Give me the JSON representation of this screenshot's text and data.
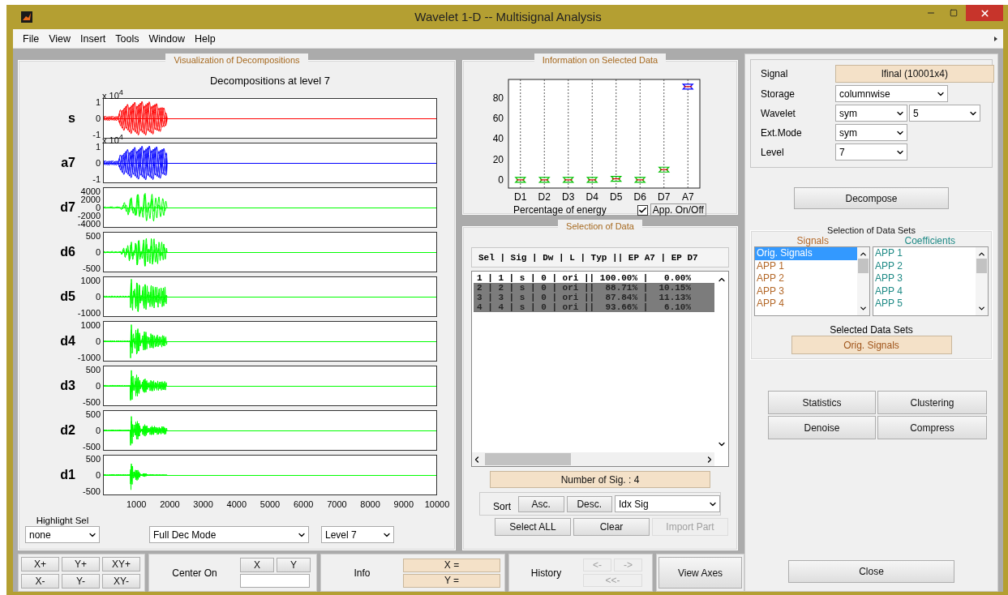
{
  "window": {
    "title": "Wavelet 1-D -- Multisignal Analysis"
  },
  "menu": [
    "File",
    "View",
    "Insert",
    "Tools",
    "Window",
    "Help"
  ],
  "decompositions": {
    "panel_title": "Visualization of Decompositions",
    "title": "Decompositions at level 7",
    "plots": [
      {
        "label": "s",
        "exponent": "x 10$^{4}$",
        "yticks": [
          "1",
          "0",
          "-1"
        ],
        "color": "#ff0000"
      },
      {
        "label": "a7",
        "exponent": "x 10$^{4}$",
        "yticks": [
          "1",
          "0",
          "-1"
        ],
        "color": "#0000ff"
      },
      {
        "label": "d7",
        "yticks": [
          "4000",
          "2000",
          "0",
          "-2000",
          "-4000"
        ],
        "color": "#00ff00"
      },
      {
        "label": "d6",
        "yticks": [
          "500",
          "0",
          "-500"
        ],
        "color": "#00ff00"
      },
      {
        "label": "d5",
        "yticks": [
          "1000",
          "0",
          "-1000"
        ],
        "color": "#00ff00"
      },
      {
        "label": "d4",
        "yticks": [
          "1000",
          "0",
          "-1000"
        ],
        "color": "#00ff00"
      },
      {
        "label": "d3",
        "yticks": [
          "500",
          "0",
          "-500"
        ],
        "color": "#00ff00"
      },
      {
        "label": "d2",
        "yticks": [
          "500",
          "0",
          "-500"
        ],
        "color": "#00ff00"
      },
      {
        "label": "d1",
        "yticks": [
          "500",
          "0",
          "-500"
        ],
        "color": "#00ff00"
      }
    ],
    "xticks": [
      "1000",
      "2000",
      "3000",
      "4000",
      "5000",
      "6000",
      "7000",
      "8000",
      "9000",
      "10000"
    ],
    "highlight": {
      "label": "Highlight Sel",
      "value": "none"
    },
    "mode": {
      "value": "Full Dec Mode"
    },
    "level": {
      "value": "Level 7"
    }
  },
  "info": {
    "panel_title": "Information on Selected Data",
    "chart_data": {
      "type": "scatter",
      "xlabel": "Percentage of energy",
      "categories": [
        "D1",
        "D2",
        "D3",
        "D4",
        "D5",
        "D6",
        "D7",
        "A7"
      ],
      "series": [
        {
          "color": "#00c000",
          "values": [
            0,
            0,
            0,
            0,
            1,
            0,
            10,
            null
          ]
        },
        {
          "color": "#0000ff",
          "values": [
            null,
            null,
            null,
            null,
            null,
            null,
            null,
            91
          ]
        }
      ],
      "ylim": [
        -8,
        98
      ],
      "yticks": [
        0,
        20,
        40,
        60,
        80
      ],
      "grid": true
    },
    "app_toggle": {
      "label": "App. On/Off",
      "checked": true
    }
  },
  "selection": {
    "panel_title": "Selection of Data",
    "header": "Sel | Sig | Dw | L | Typ || EP A7 | EP D7",
    "rows": [
      {
        "text": "1 | 1 | s | 0 | ori || 100.00% |   0.00%",
        "selected": false
      },
      {
        "text": "2 | 2 | s | 0 | ori ||  88.71% |  10.15%",
        "selected": true
      },
      {
        "text": "3 | 3 | s | 0 | ori ||  87.84% |  11.13%",
        "selected": true
      },
      {
        "text": "4 | 4 | s | 0 | ori ||  93.66% |   6.10%",
        "selected": true
      }
    ],
    "count": "Number of Sig. : 4",
    "sort_label": "Sort",
    "sort_buttons": [
      "Asc.",
      "Desc."
    ],
    "sort_by": "Idx Sig",
    "actions": [
      {
        "label": "Select ALL",
        "disabled": false
      },
      {
        "label": "Clear",
        "disabled": false
      },
      {
        "label": "Import Part",
        "disabled": true
      }
    ]
  },
  "settings": {
    "signal": {
      "label": "Signal",
      "value": "lfinal (10001x4)"
    },
    "storage": {
      "label": "Storage",
      "value": "columnwise"
    },
    "wavelet": {
      "label": "Wavelet",
      "family": "sym",
      "order": "5"
    },
    "ext_mode": {
      "label": "Ext.Mode",
      "value": "sym"
    },
    "level": {
      "label": "Level",
      "value": "7"
    }
  },
  "decompose_button": "Decompose",
  "data_sets": {
    "title": "Selection of Data Sets",
    "signals": {
      "title": "Signals",
      "items": [
        {
          "label": "Orig. Signals",
          "selected": true
        },
        {
          "label": "APP 1",
          "selected": false
        },
        {
          "label": "APP 2",
          "selected": false
        },
        {
          "label": "APP 3",
          "selected": false
        },
        {
          "label": "APP 4",
          "selected": false
        }
      ]
    },
    "coefficients": {
      "title": "Coefficients",
      "items": [
        {
          "label": "APP 1",
          "selected": false
        },
        {
          "label": "APP 2",
          "selected": false
        },
        {
          "label": "APP 3",
          "selected": false
        },
        {
          "label": "APP 4",
          "selected": false
        },
        {
          "label": "APP 5",
          "selected": false
        }
      ]
    },
    "selected_title": "Selected Data Sets",
    "selected_value": "Orig. Signals"
  },
  "tools": [
    "Statistics",
    "Clustering",
    "Denoise",
    "Compress"
  ],
  "close_button": "Close",
  "axes_controls": [
    "X+",
    "Y+",
    "XY+",
    "X-",
    "Y-",
    "XY-"
  ],
  "center_on": {
    "label": "Center On",
    "buttons": [
      "X",
      "Y"
    ]
  },
  "info_bar": {
    "label": "Info",
    "x": "X =",
    "y": "Y ="
  },
  "history": {
    "label": "History",
    "buttons": [
      {
        "label": "<-",
        "disabled": true
      },
      {
        "label": "->",
        "disabled": true
      },
      {
        "label": "<<-",
        "disabled": true
      }
    ]
  },
  "view_axes": "View Axes"
}
